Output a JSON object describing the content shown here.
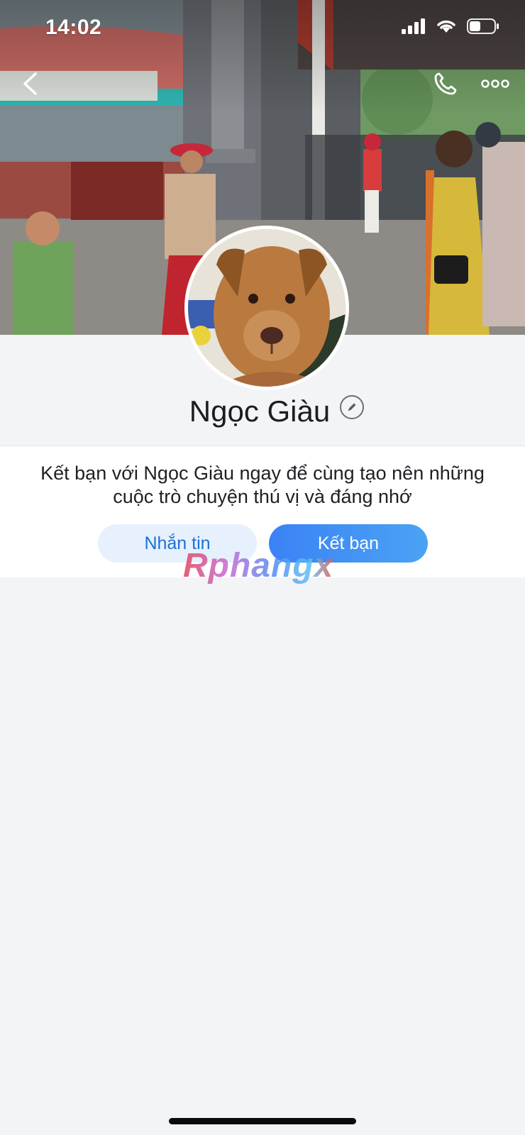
{
  "status_bar": {
    "time": "14:02",
    "icons": [
      "signal-icon",
      "wifi-icon",
      "battery-icon"
    ]
  },
  "nav": {
    "back_icon": "chevron-left-icon",
    "call_icon": "phone-icon",
    "more_icon": "more-dots-icon"
  },
  "profile": {
    "name": "Ngọc Giàu",
    "edit_icon": "pencil-icon"
  },
  "invite": {
    "text": "Kết bạn với Ngọc Giàu ngay để cùng tạo nên những cuộc trò chuyện thú vị và đáng nhớ",
    "message_label": "Nhắn tin",
    "add_friend_label": "Kết bạn"
  },
  "watermark": {
    "text": "Rphangx"
  },
  "colors": {
    "accent": "#3b82f6",
    "message_button_bg": "#e6f1fd",
    "message_button_text": "#1d6fd8",
    "page_bg": "#f3f4f6"
  }
}
